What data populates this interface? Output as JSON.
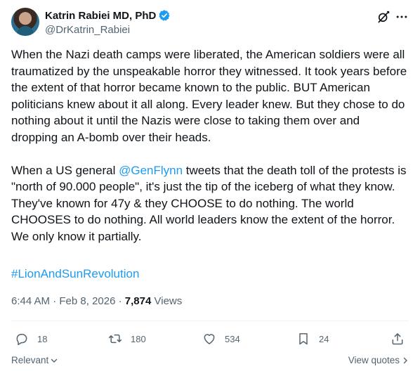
{
  "author": {
    "display_name": "Katrin Rabiei MD, PhD",
    "handle": "@DrKatrin_Rabiei",
    "verified": true
  },
  "icons": {
    "verified": "verified-badge-icon",
    "grok": "grok-icon",
    "more": "more-icon",
    "reply": "reply-icon",
    "retweet": "retweet-icon",
    "like": "heart-icon",
    "bookmark": "bookmark-icon",
    "share": "share-icon"
  },
  "tweet": {
    "paragraph1": "When the Nazi death camps were liberated, the American soldiers were all traumatized by the unspeakable horror they witnessed. It took years before the extent of that horror became known to the public. BUT American politicians knew about it all along. Every leader knew. But they chose to do nothing about it until the Nazis were close to taking them over and dropping an A-bomb over their heads.",
    "paragraph2_before": "When a US general ",
    "mention": "@GenFlynn",
    "paragraph2_after": " tweets that the death toll of the protests is \"north of 90.000 people\", it's just the tip of the iceberg of what they know. They've known for 47y & they CHOOSE to do nothing. The world CHOOSES to do nothing. All world leaders know the extent of the horror. We only know it partially.",
    "hashtag": "#LionAndSunRevolution"
  },
  "meta": {
    "time": "6:44 AM",
    "separator": "·",
    "date": "Feb 8, 2026",
    "views_count": "7,874",
    "views_label": "Views"
  },
  "actions": {
    "replies": "18",
    "retweets": "180",
    "likes": "534",
    "bookmarks": "24"
  },
  "footer": {
    "sort_label": "Relevant",
    "view_quotes_label": "View quotes"
  },
  "colors": {
    "accent": "#1d9bf0",
    "text": "#0f1419",
    "secondary": "#536471",
    "divider": "#eff3f4"
  }
}
